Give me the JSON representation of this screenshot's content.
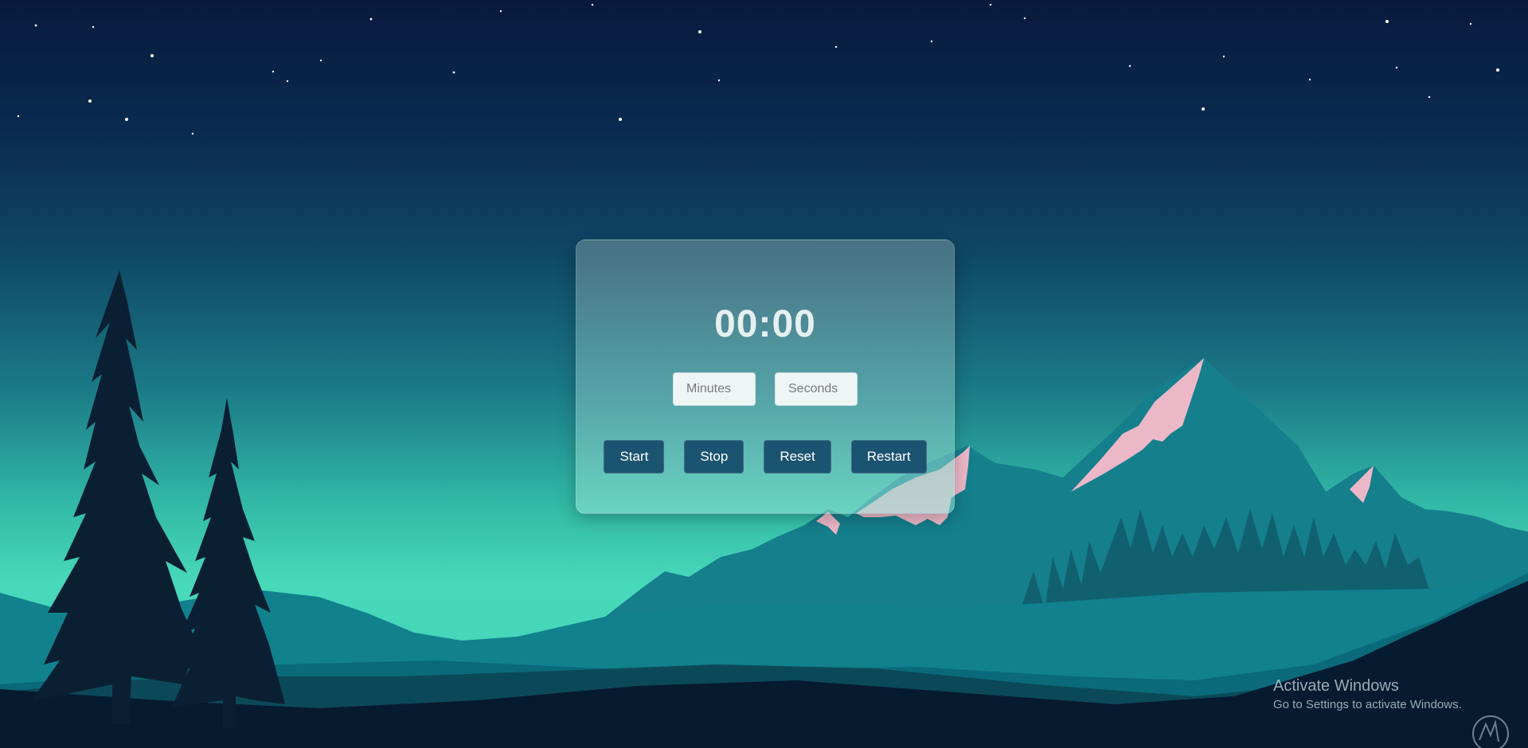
{
  "timer": {
    "display": "00:00",
    "minutes_placeholder": "Minutes",
    "seconds_placeholder": "Seconds",
    "minutes_value": "",
    "seconds_value": ""
  },
  "controls": {
    "start_label": "Start",
    "stop_label": "Stop",
    "reset_label": "Reset",
    "restart_label": "Restart"
  },
  "watermark": {
    "title": "Activate Windows",
    "subtitle": "Go to Settings to activate Windows."
  },
  "colors": {
    "sky_top": "#071a3e",
    "sky_bottom": "#48d9bb",
    "button_bg": "#1b5470",
    "snow_caps": "#ecb8c8",
    "tree_silhouette": "#0b1f33"
  }
}
